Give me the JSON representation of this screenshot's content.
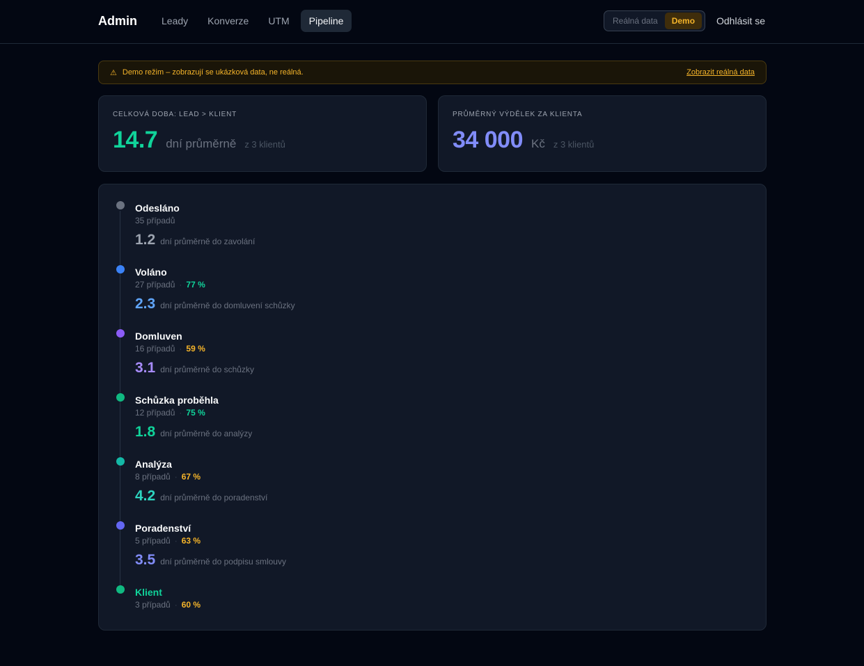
{
  "nav": {
    "brand": "Admin",
    "items": [
      {
        "label": "Leady",
        "active": false
      },
      {
        "label": "Konverze",
        "active": false
      },
      {
        "label": "UTM",
        "active": false
      },
      {
        "label": "Pipeline",
        "active": true
      }
    ],
    "mode_toggle": {
      "real": "Reálná data",
      "demo": "Demo",
      "selected": "Demo"
    },
    "logout": "Odhlásit se"
  },
  "banner": {
    "icon": "warning-icon",
    "text": "Demo režim – zobrazují se ukázková data, ne reálná.",
    "link": "Zobrazit reálná data",
    "color": "#f5b42a"
  },
  "cards": {
    "duration": {
      "label": "Celková doba: Lead > Klient",
      "value": "14.7",
      "unit": "dní průměrně",
      "sub": "z 3 klientů",
      "color": "#10d39a"
    },
    "earnings": {
      "label": "Průměrný výdělek za klienta",
      "value": "34 000",
      "unit": "Kč",
      "sub": "z 3 klientů",
      "color": "#818cf8"
    }
  },
  "pipeline": {
    "stages": [
      {
        "name": "Odesláno",
        "count": "35 případů",
        "rate": "",
        "rate_color": "",
        "dot_color": "#6b7280",
        "avg": "1.2",
        "avg_text": "dní průměrně do zavolání",
        "avg_color": "#9ca3af",
        "name_color": "#f9fafb"
      },
      {
        "name": "Voláno",
        "count": "27 případů",
        "rate": "77 %",
        "rate_color": "#10d39a",
        "dot_color": "#3b82f6",
        "avg": "2.3",
        "avg_text": "dní průměrně do domluvení schůzky",
        "avg_color": "#60a5fa",
        "name_color": "#f9fafb"
      },
      {
        "name": "Domluven",
        "count": "16 případů",
        "rate": "59 %",
        "rate_color": "#f5b42a",
        "dot_color": "#8b5cf6",
        "avg": "3.1",
        "avg_text": "dní průměrně do schůzky",
        "avg_color": "#a78bfa",
        "name_color": "#f9fafb"
      },
      {
        "name": "Schůzka proběhla",
        "count": "12 případů",
        "rate": "75 %",
        "rate_color": "#10d39a",
        "dot_color": "#10b981",
        "avg": "1.8",
        "avg_text": "dní průměrně do analýzy",
        "avg_color": "#10d39a",
        "name_color": "#f9fafb"
      },
      {
        "name": "Analýza",
        "count": "8 případů",
        "rate": "67 %",
        "rate_color": "#f5b42a",
        "dot_color": "#14b8a6",
        "avg": "4.2",
        "avg_text": "dní průměrně do poradenství",
        "avg_color": "#2dd4bf",
        "name_color": "#f9fafb"
      },
      {
        "name": "Poradenství",
        "count": "5 případů",
        "rate": "63 %",
        "rate_color": "#f5b42a",
        "dot_color": "#6366f1",
        "avg": "3.5",
        "avg_text": "dní průměrně do podpisu smlouvy",
        "avg_color": "#818cf8",
        "name_color": "#f9fafb"
      },
      {
        "name": "Klient",
        "count": "3 případů",
        "rate": "60 %",
        "rate_color": "#f5b42a",
        "dot_color": "#10b981",
        "avg": "",
        "avg_text": "",
        "avg_color": "",
        "name_color": "#10d39a"
      }
    ]
  }
}
